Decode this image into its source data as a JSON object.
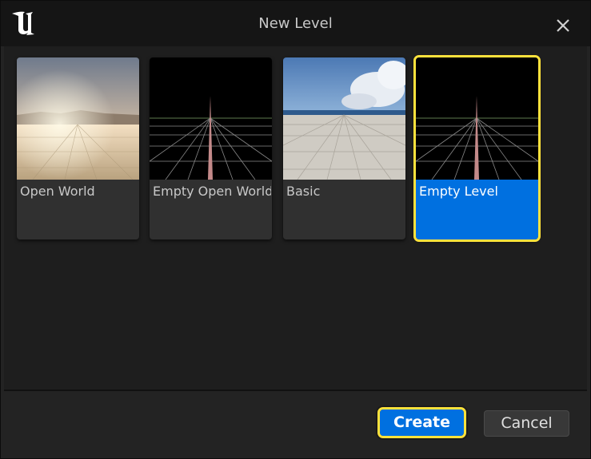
{
  "dialog": {
    "title": "New Level",
    "close_icon": "close-icon",
    "logo_icon": "unreal-logo-icon"
  },
  "templates": [
    {
      "label": "Open World",
      "thumb": "open-world-thumbnail",
      "selected": false
    },
    {
      "label": "Empty Open World",
      "thumb": "empty-grid-thumbnail",
      "selected": false
    },
    {
      "label": "Basic",
      "thumb": "basic-thumbnail",
      "selected": false
    },
    {
      "label": "Empty Level",
      "thumb": "empty-grid-thumbnail",
      "selected": true
    }
  ],
  "buttons": {
    "create_label": "Create",
    "cancel_label": "Cancel"
  },
  "colors": {
    "accent": "#0070e0",
    "selection": "#ffe23c"
  }
}
